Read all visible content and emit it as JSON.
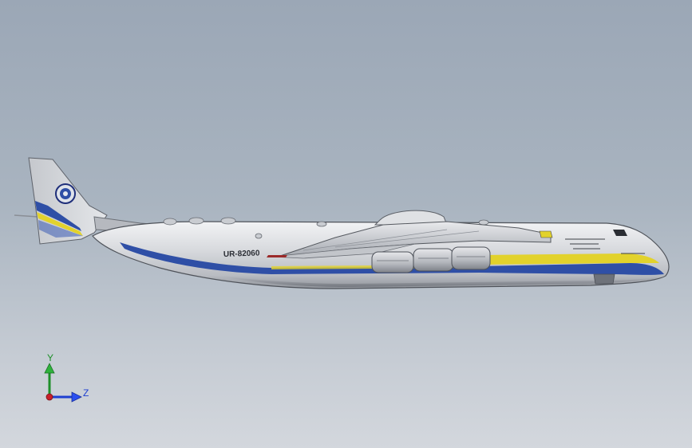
{
  "viewport": {
    "background_top": "#9ba7b6",
    "background_bottom": "#d3d7dd"
  },
  "model": {
    "registration": "UR-82060",
    "livery_colors": {
      "yellow": "#e2d22c",
      "blue": "#2f4fa6",
      "fuselage": "#d2d4d8"
    }
  },
  "triad": {
    "y_label": "Y",
    "z_label": "Z",
    "y_color": "#1e8f2a",
    "z_color": "#1e3fd1",
    "origin_color": "#c8202a"
  }
}
